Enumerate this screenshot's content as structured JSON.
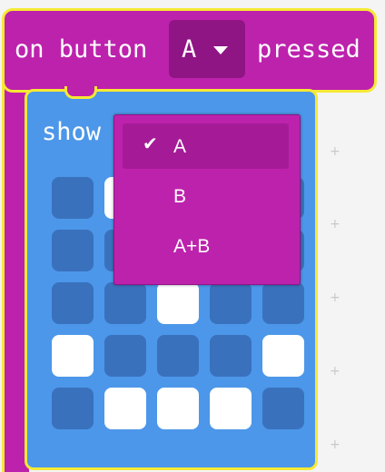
{
  "hat_block": {
    "label_before": "on button",
    "dropdown_value": "A",
    "label_after": "pressed"
  },
  "show_block": {
    "label": "show",
    "grid": [
      [
        0,
        1,
        1,
        0,
        0
      ],
      [
        0,
        0,
        0,
        0,
        0
      ],
      [
        0,
        0,
        1,
        0,
        0
      ],
      [
        1,
        0,
        0,
        0,
        1
      ],
      [
        0,
        1,
        1,
        1,
        0
      ]
    ]
  },
  "dropdown_menu": {
    "items": [
      {
        "label": "A",
        "selected": true
      },
      {
        "label": "B",
        "selected": false
      },
      {
        "label": "A+B",
        "selected": false
      }
    ]
  },
  "colors": {
    "block_pink": "#bd22ad",
    "block_blue": "#4c97e9",
    "highlight_yellow": "#f6e934",
    "led_off": "#3a71bd",
    "led_on": "#ffffff"
  }
}
